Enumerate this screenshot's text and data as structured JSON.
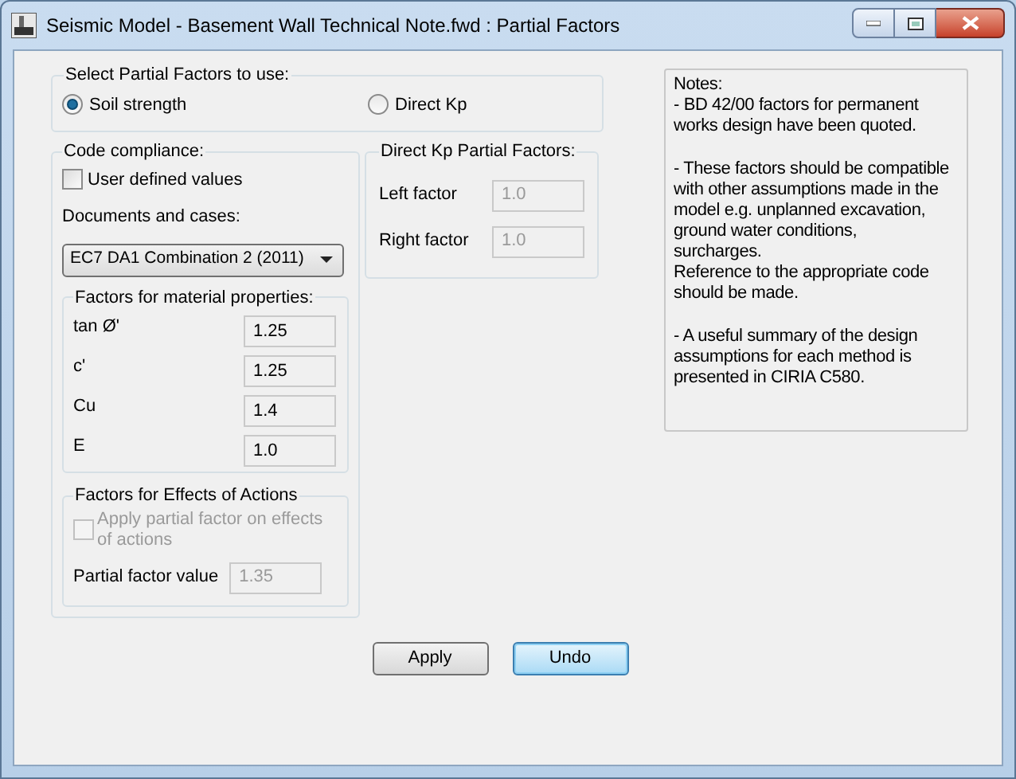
{
  "window": {
    "title": "Seismic Model - Basement Wall Technical Note.fwd : Partial Factors"
  },
  "partial_factors_group": {
    "title": "Select Partial Factors to use:",
    "options": [
      {
        "label": "Soil strength",
        "selected": true
      },
      {
        "label": "Direct Kp",
        "selected": false
      }
    ]
  },
  "code_compliance": {
    "title": "Code compliance:",
    "user_defined": {
      "label": "User defined values",
      "checked": false,
      "disabled": false
    },
    "documents_label": "Documents and cases:",
    "documents_dropdown": {
      "value": "EC7 DA1 Combination 2 (2011)"
    },
    "material_group": {
      "title": "Factors for material properties:",
      "fields": [
        {
          "label": "tan Ø'",
          "value": "1.25",
          "disabled": false
        },
        {
          "label": "c'",
          "value": "1.25",
          "disabled": false
        },
        {
          "label": "Cu",
          "value": "1.4",
          "disabled": false
        },
        {
          "label": "E",
          "value": "1.0",
          "disabled": false
        }
      ]
    },
    "effects_group": {
      "title": "Factors for Effects of Actions",
      "apply_checkbox": {
        "label": "Apply partial factor on effects of actions",
        "checked": false,
        "disabled": true
      },
      "field": {
        "label": "Partial factor value",
        "value": "1.35",
        "disabled": true
      }
    }
  },
  "direct_kp_group": {
    "title": "Direct Kp Partial Factors:",
    "fields": [
      {
        "label": "Left factor",
        "value": "1.0",
        "disabled": true
      },
      {
        "label": "Right factor",
        "value": "1.0",
        "disabled": true
      }
    ]
  },
  "notes": {
    "title": "Notes:",
    "paragraphs": [
      [
        "- BD 42/00 factors for permanent works design have been quoted."
      ],
      [
        "- These factors should be compatible with other assumptions made in the model e.g. unplanned excavation, ground water conditions,",
        "surcharges.",
        "Reference to the appropriate code should be made."
      ],
      [
        "- A useful summary of the design assumptions for each method is presented in CIRIA C580."
      ]
    ]
  },
  "buttons": [
    {
      "label": "Apply",
      "default": false
    },
    {
      "label": "Undo",
      "default": true
    }
  ]
}
